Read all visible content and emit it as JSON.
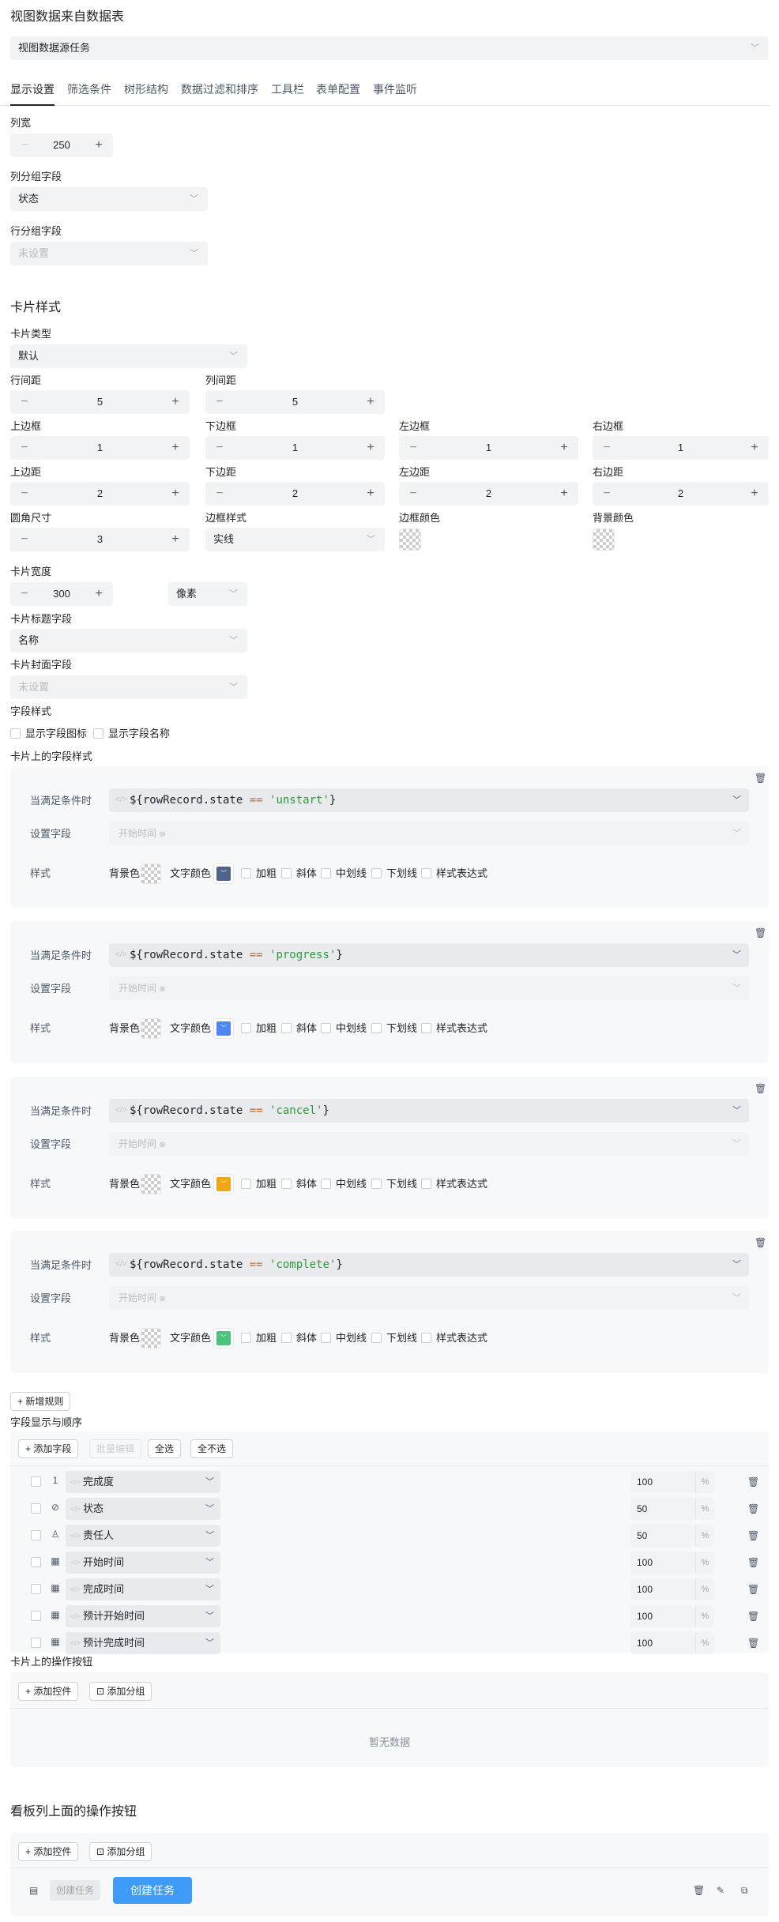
{
  "page": {
    "title": "视图数据来自数据表",
    "source_select": "视图数据源任务"
  },
  "tabs": [
    "显示设置",
    "筛选条件",
    "树形结构",
    "数据过滤和排序",
    "工具栏",
    "表单配置",
    "事件监听"
  ],
  "display": {
    "col_width_label": "列宽",
    "col_width": "250",
    "col_group_label": "列分组字段",
    "col_group_value": "状态",
    "row_group_label": "行分组字段",
    "row_group_placeholder": "未设置"
  },
  "card": {
    "section_title": "卡片样式",
    "type_label": "卡片类型",
    "type_value": "默认",
    "row_gap_label": "行间距",
    "row_gap": "5",
    "col_gap_label": "列间距",
    "col_gap": "5",
    "border_top_label": "上边框",
    "border_top": "1",
    "border_bottom_label": "下边框",
    "border_bottom": "1",
    "border_left_label": "左边框",
    "border_left": "1",
    "border_right_label": "右边框",
    "border_right": "1",
    "pad_top_label": "上边距",
    "pad_top": "2",
    "pad_bottom_label": "下边距",
    "pad_bottom": "2",
    "pad_left_label": "左边距",
    "pad_left": "2",
    "pad_right_label": "右边距",
    "pad_right": "2",
    "radius_label": "圆角尺寸",
    "radius": "3",
    "border_style_label": "边框样式",
    "border_style": "实线",
    "border_color_label": "边框颜色",
    "bg_color_label": "背景颜色",
    "width_label": "卡片宽度",
    "width": "300",
    "width_unit": "像素",
    "title_field_label": "卡片标题字段",
    "title_field": "名称",
    "cover_field_label": "卡片封面字段",
    "cover_field_placeholder": "未设置",
    "field_style_label": "字段样式",
    "show_icon_label": "显示字段图标",
    "show_name_label": "显示字段名称",
    "field_styles_title": "卡片上的字段样式"
  },
  "rule_labels": {
    "when": "当满足条件时",
    "set_field": "设置字段",
    "style": "样式",
    "bg": "背景色",
    "text_color": "文字颜色",
    "bold": "加粗",
    "italic": "斜体",
    "strike": "中划线",
    "underline": "下划线",
    "expr": "样式表达式"
  },
  "rules": [
    {
      "prefix": "${rowRecord.state ",
      "op": "==",
      "str": "'unstart'",
      "suffix": "}",
      "field": "开始时间",
      "color": "#4e6389"
    },
    {
      "prefix": "${rowRecord.state ",
      "op": "==",
      "str": "'progress'",
      "suffix": "}",
      "field": "开始时间",
      "color": "#4d86f0"
    },
    {
      "prefix": "${rowRecord.state ",
      "op": "==",
      "str": "'cancel'",
      "suffix": "}",
      "field": "开始时间",
      "color": "#f2a516"
    },
    {
      "prefix": "${rowRecord.state ",
      "op": "==",
      "str": "'complete'",
      "suffix": "}",
      "field": "开始时间",
      "color": "#4cc37c"
    }
  ],
  "add_rule_label": "新增规则",
  "fields_section": {
    "title": "字段显示与顺序",
    "add_field": "添加字段",
    "batch_edit": "批量编辑",
    "select_all": "全选",
    "select_none": "全不选",
    "rows": [
      {
        "icon": "1",
        "name": "完成度",
        "width": "100"
      },
      {
        "icon": "⊘",
        "name": "状态",
        "width": "50"
      },
      {
        "icon": "♙",
        "name": "责任人",
        "width": "50"
      },
      {
        "icon": "▦",
        "name": "开始时间",
        "width": "100"
      },
      {
        "icon": "▦",
        "name": "完成时间",
        "width": "100"
      },
      {
        "icon": "▦",
        "name": "预计开始时间",
        "width": "100"
      },
      {
        "icon": "▦",
        "name": "预计完成时间",
        "width": "100"
      }
    ],
    "pct": "%"
  },
  "card_actions": {
    "title": "卡片上的操作按钮",
    "add_control": "添加控件",
    "add_group": "添加分组",
    "empty": "暂无数据"
  },
  "board_actions": {
    "title": "看板列上面的操作按钮",
    "add_control": "添加控件",
    "add_group": "添加分组",
    "create_task_placeholder": "创建任务",
    "create_task_button": "创建任务"
  },
  "colors": {
    "primary": "#3e9bf7"
  }
}
